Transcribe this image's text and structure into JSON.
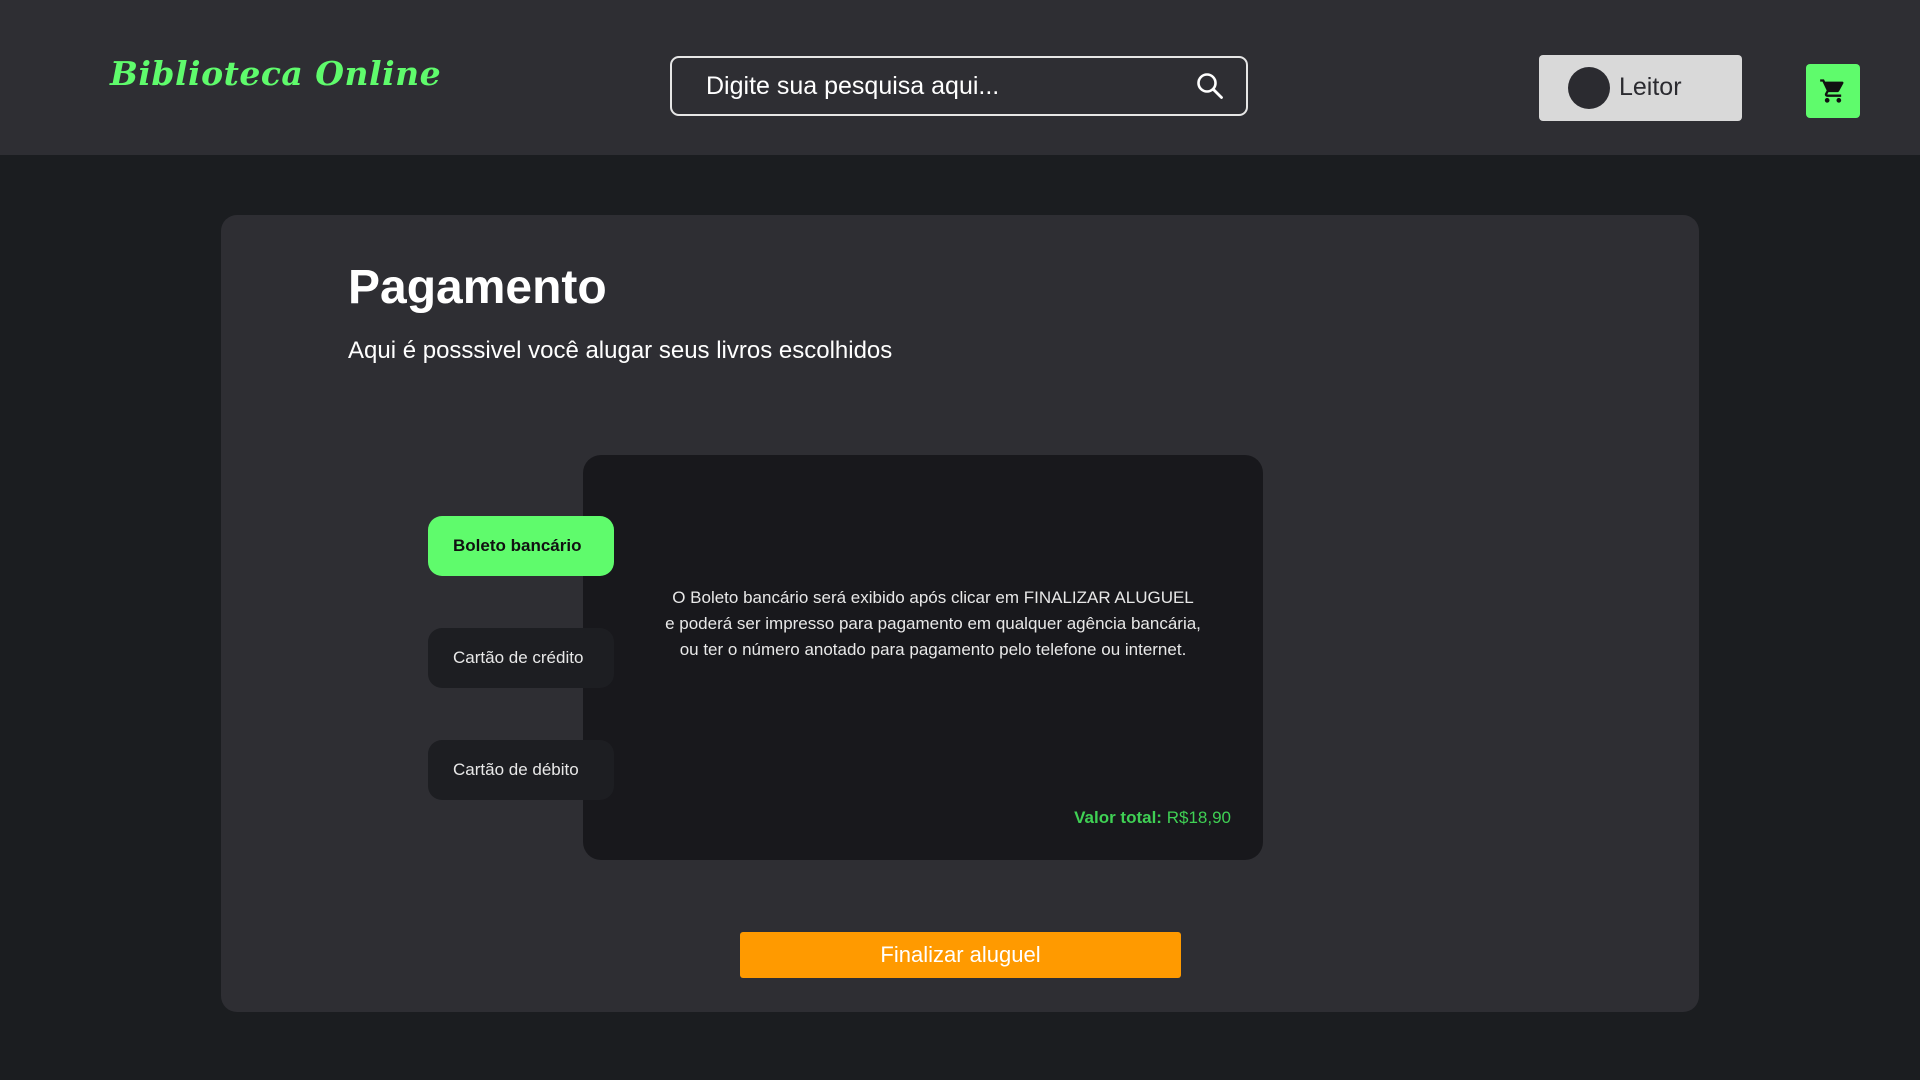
{
  "header": {
    "logo": "Biblioteca Online",
    "search": {
      "placeholder": "Digite sua pesquisa aqui..."
    },
    "user": {
      "label": "Leitor"
    },
    "icons": {
      "search": "search-icon",
      "cart": "cart-icon"
    }
  },
  "main": {
    "title": "Pagamento",
    "subtitle": "Aqui é posssivel você alugar seus livros escolhidos",
    "payment_methods": [
      {
        "label": "Boleto bancário",
        "selected": true
      },
      {
        "label": "Cartão de crédito",
        "selected": false
      },
      {
        "label": "Cartão de débito",
        "selected": false
      }
    ],
    "info": {
      "lines": [
        "O Boleto bancário será exibido após clicar em FINALIZAR ALUGUEL",
        "e poderá ser impresso para pagamento em qualquer agência bancária,",
        "ou ter o número anotado para pagamento pelo telefone ou internet."
      ],
      "total_label": "Valor total:",
      "total_value": "R$18,90"
    },
    "finalize_label": "Finalizar aluguel"
  },
  "colors": {
    "accent_green": "#5ffb6c",
    "total_green": "#3fd054",
    "finalize_orange": "#ff9a00",
    "background": "#1b1d20",
    "surface": "#2e2e33",
    "panel": "#18181c"
  }
}
